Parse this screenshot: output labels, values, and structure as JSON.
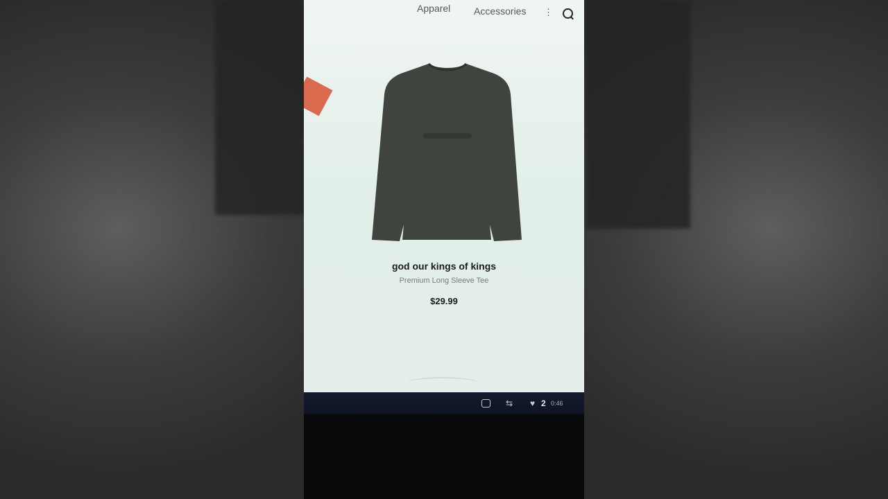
{
  "nav": {
    "apparel": "Apparel",
    "accessories": "Accessories",
    "more": "⋮"
  },
  "product": {
    "title": "god our kings of kings",
    "subtitle": "Premium Long Sleeve Tee",
    "price": "$29.99"
  },
  "footer": {
    "likes": "2",
    "time": "0:46"
  },
  "colors": {
    "shirt": "#3f443f",
    "accent_tag": "#d96a4e",
    "page_bg": "#e6f0eb",
    "footer_bg": "#131a2a"
  },
  "icons": [
    "search-icon",
    "comment-icon",
    "share-icon",
    "heart-icon"
  ]
}
